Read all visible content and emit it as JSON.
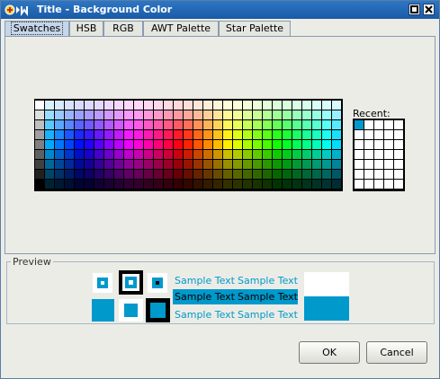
{
  "window": {
    "title": "Title - Background Color"
  },
  "tabs": [
    {
      "label": "Swatches",
      "mnemonic": "S",
      "rest": "watches",
      "active": true
    },
    {
      "label": "HSB",
      "mnemonic": "H",
      "rest": "SB",
      "active": false
    },
    {
      "label": "RGB",
      "pre": "R",
      "mnemonic": "G",
      "rest": "B",
      "active": false
    },
    {
      "label": "AWT Palette",
      "active": false
    },
    {
      "label": "Star Palette",
      "active": false
    }
  ],
  "swatches": {
    "recent_label": "Recent:",
    "recent_selected_color": "#0099cc"
  },
  "preview": {
    "label": "Preview",
    "sample_text": "Sample Text",
    "color": "#0099cc"
  },
  "buttons": {
    "ok": "OK",
    "cancel": "Cancel"
  },
  "icons": {
    "app": "java-duke-icon",
    "minimize": "minimize-icon",
    "close": "close-icon"
  }
}
